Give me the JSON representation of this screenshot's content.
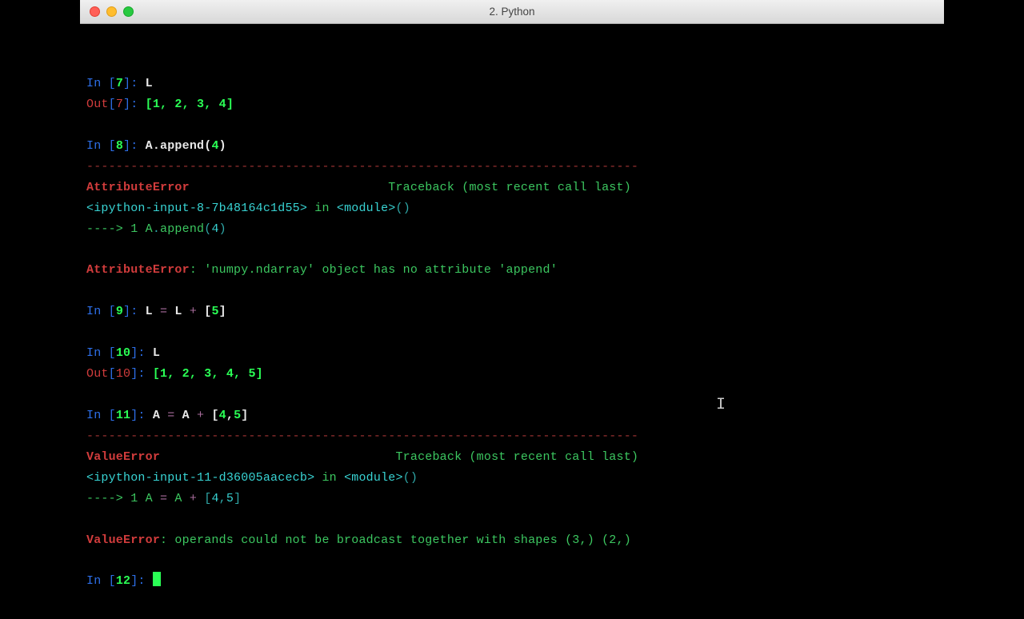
{
  "titlebar": {
    "title": "2. Python"
  },
  "lines": {
    "l1_in": "In ",
    "l1_br1": "[",
    "l1_num": "7",
    "l1_br2": "]:",
    "l1_code": " L",
    "l2_out": "Out",
    "l2_br1": "[",
    "l2_num": "7",
    "l2_br2": "]:",
    "l2_val": " [1, 2, 3, 4]",
    "l3_in": "In ",
    "l3_br1": "[",
    "l3_num": "8",
    "l3_br2": "]:",
    "l3_code_a": " A",
    "l3_code_b": ".",
    "l3_code_c": "append",
    "l3_code_d": "(",
    "l3_code_e": "4",
    "l3_code_f": ")",
    "l4_dash": "---------------------------------------------------------------------------",
    "l5_err": "AttributeError",
    "l5_tb": "                           Traceback (most recent call last)",
    "l6_a": "<ipython-input-",
    "l6_b": "8",
    "l6_c": "-",
    "l6_d": "7b48164c1d55",
    "l6_e": ">",
    "l6_f": " in ",
    "l6_g": "<module>",
    "l6_h": "()",
    "l7_ar": "----> 1",
    "l7_sp": " ",
    "l7_a": "A",
    "l7_b": ".",
    "l7_c": "append",
    "l7_d": "(",
    "l7_e": "4",
    "l7_f": ")",
    "l8_err": "AttributeError",
    "l8_col": ": ",
    "l8_msg": "'numpy.ndarray' object has no attribute 'append'",
    "l9_in": "In ",
    "l9_br1": "[",
    "l9_num": "9",
    "l9_br2": "]:",
    "l9_code": " L ",
    "l9_eq": "=",
    "l9_code2": " L ",
    "l9_plus": "+",
    "l9_code3": " [",
    "l9_val": "5",
    "l9_code4": "]",
    "l10_in": "In ",
    "l10_br1": "[",
    "l10_num": "10",
    "l10_br2": "]:",
    "l10_code": " L",
    "l11_out": "Out",
    "l11_br1": "[",
    "l11_num": "10",
    "l11_br2": "]:",
    "l11_val": " [1, 2, 3, 4, 5]",
    "l12_in": "In ",
    "l12_br1": "[",
    "l12_num": "11",
    "l12_br2": "]:",
    "l12_code": " A ",
    "l12_eq": "=",
    "l12_code2": " A ",
    "l12_plus": "+",
    "l12_code3": " [",
    "l12_v1": "4",
    "l12_c": ",",
    "l12_v2": "5",
    "l12_code4": "]",
    "l13_dash": "---------------------------------------------------------------------------",
    "l14_err": "ValueError",
    "l14_tb": "                                Traceback (most recent call last)",
    "l15_a": "<ipython-input-",
    "l15_b": "11",
    "l15_c": "-",
    "l15_d": "d36005aacecb",
    "l15_e": ">",
    "l15_f": " in ",
    "l15_g": "<module>",
    "l15_h": "()",
    "l16_ar": "----> 1",
    "l16_sp": " ",
    "l16_a": "A ",
    "l16_eq": "=",
    "l16_b": " A ",
    "l16_plus": "+",
    "l16_c": " [",
    "l16_v1": "4",
    "l16_com": ",",
    "l16_v2": "5",
    "l16_d": "]",
    "l17_err": "ValueError",
    "l17_col": ": ",
    "l17_msg": "operands could not be broadcast together with shapes (3,) (2,)",
    "l18_in": "In ",
    "l18_br1": "[",
    "l18_num": "12",
    "l18_br2": "]:",
    "l18_sp": " "
  }
}
